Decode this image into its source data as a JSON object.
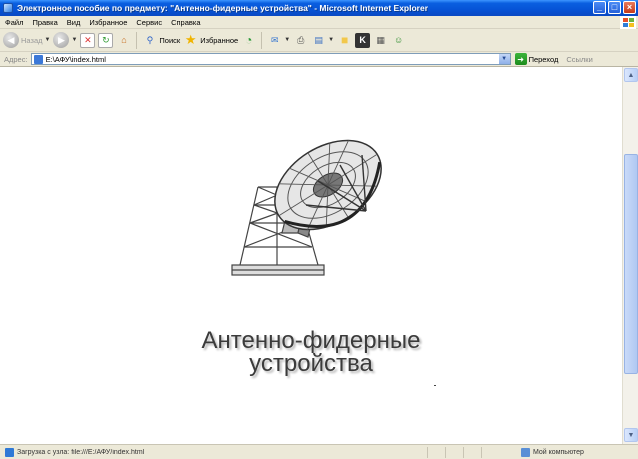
{
  "window": {
    "title": "Электронное пособие по предмету: \"Антенно-фидерные устройства\" - Microsoft Internet Explorer",
    "minimize": "_",
    "maximize": "□",
    "close": "×"
  },
  "menu": {
    "items": [
      "Файл",
      "Правка",
      "Вид",
      "Избранное",
      "Сервис",
      "Справка"
    ]
  },
  "toolbar": {
    "back_label": "Назад",
    "search_label": "Поиск",
    "favorites_label": "Избранное"
  },
  "address": {
    "label": "Адрес:",
    "value": "E:\\АФУ\\index.html",
    "go_label": "Переход",
    "links_label": "Ссылки"
  },
  "page": {
    "headline_line1": "Антенно-фидерные",
    "headline_line2": "устройства"
  },
  "status": {
    "text": "Загрузка с узла: file:///E:/АФУ/index.html",
    "zone": "Мой компьютер"
  },
  "colors": {
    "titlebar": "#0653d6",
    "chrome": "#ece9d8",
    "headline": "#3b3b3b"
  }
}
